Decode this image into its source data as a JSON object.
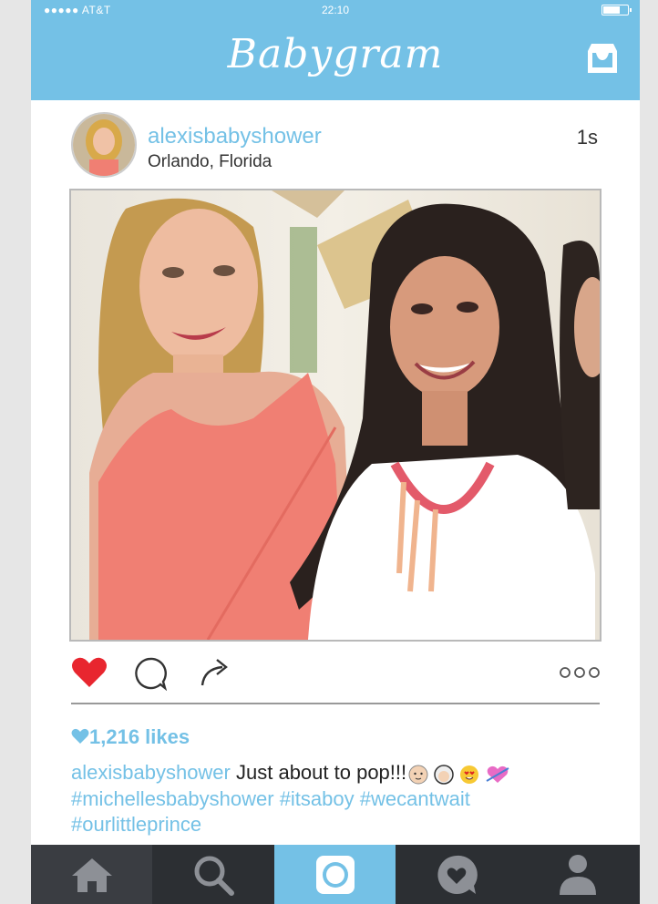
{
  "status_bar": {
    "carrier": "●●●●● AT&T",
    "time": "22:10"
  },
  "app": {
    "title": "Babygram"
  },
  "post": {
    "username": "alexisbabyshower",
    "location": "Orlando, Florida",
    "time_ago": "1s",
    "likes": "1,216 likes",
    "caption_user": "alexisbabyshower",
    "caption_text": "Just about to pop!!!",
    "hashtags": [
      "#michellesbabyshower",
      "#itsaboy",
      "#wecantwait",
      "#ourlittleprince"
    ]
  },
  "icons": {
    "inbox": "inbox-icon",
    "like": "heart-icon",
    "comment": "comment-icon",
    "share": "share-icon",
    "more": "more-icon"
  },
  "tabbar": {
    "tabs": [
      "home-icon",
      "search-icon",
      "camera-icon",
      "activity-icon",
      "profile-icon"
    ],
    "active": "camera-icon"
  },
  "colors": {
    "accent": "#74c1e6",
    "tabbar": "#2c2f33",
    "like": "#e8262f"
  }
}
